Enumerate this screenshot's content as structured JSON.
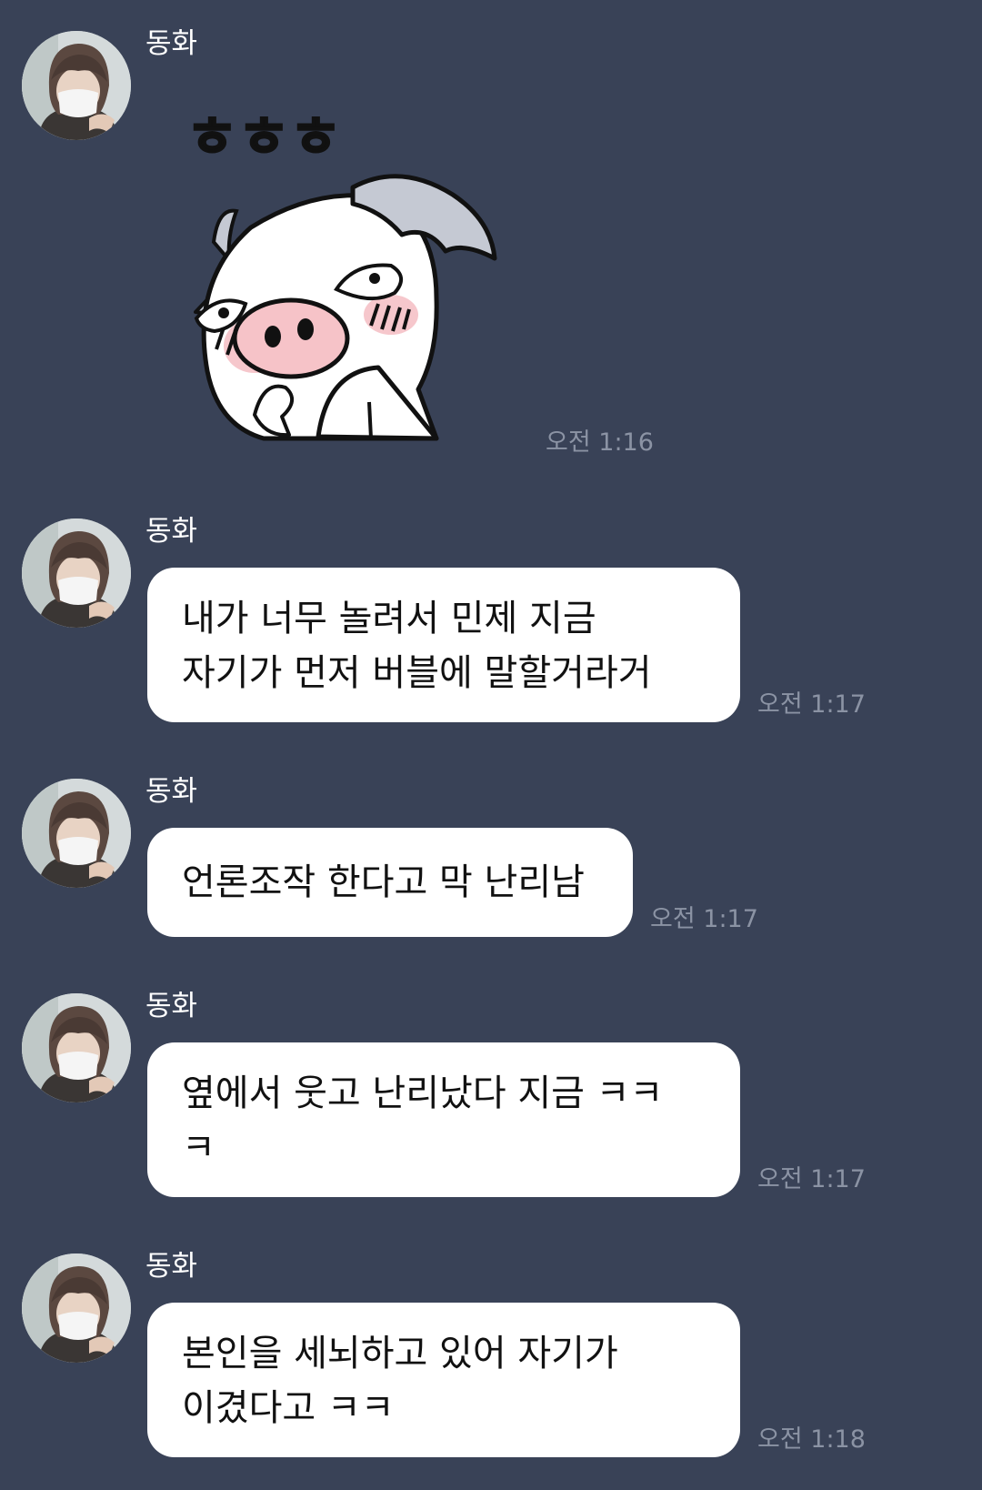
{
  "messages": [
    {
      "sender": "동화",
      "type": "sticker",
      "time": "오전 1:16",
      "sticker_text": "ㅎㅎㅎ"
    },
    {
      "sender": "동화",
      "type": "text",
      "text": "내가 너무 놀려서 민제 지금\n자기가 먼저 버블에 말할거라거",
      "time": "오전 1:17"
    },
    {
      "sender": "동화",
      "type": "text",
      "text": "언론조작 한다고 막 난리남",
      "time": "오전 1:17"
    },
    {
      "sender": "동화",
      "type": "text",
      "text": "옆에서 웃고 난리났다 지금 ㅋㅋ\nㅋ",
      "time": "오전 1:17"
    },
    {
      "sender": "동화",
      "type": "text",
      "text": "본인을 세뇌하고 있어 자기가\n이겼다고 ㅋㅋ",
      "time": "오전 1:18"
    }
  ],
  "colors": {
    "background": "#394257",
    "bubble": "#ffffff",
    "sender_text": "#ffffff",
    "time_text": "#8b93a4"
  },
  "icons": {
    "avatar": "profile-photo",
    "sticker": "pig-sticker"
  }
}
